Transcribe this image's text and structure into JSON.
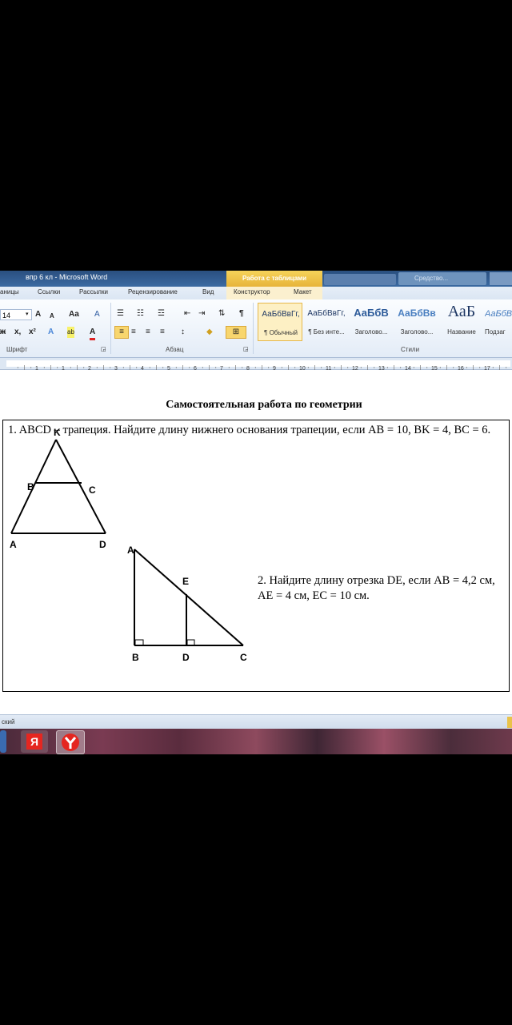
{
  "window": {
    "title": "впр 6 кл  -  Microsoft Word",
    "context_tab_header": "Работа с таблицами",
    "blurred_right_label": "Средство..."
  },
  "tabs": [
    "аницы",
    "Ссылки",
    "Рассылки",
    "Рецензирование",
    "Вид",
    "Конструктор",
    "Макет"
  ],
  "ribbon": {
    "font_size": "14",
    "groups": {
      "font": "Шрифт",
      "paragraph": "Абзац",
      "styles": "Стили"
    },
    "styles": [
      {
        "sample": "АаБбВвГг,",
        "name": "¶ Обычный"
      },
      {
        "sample": "АаБбВвГг,",
        "name": "¶ Без инте..."
      },
      {
        "sample": "АаБбВ",
        "name": "Заголово..."
      },
      {
        "sample": "АаБбВв",
        "name": "Заголово..."
      },
      {
        "sample": "АаБ",
        "name": "Название"
      },
      {
        "sample": "АаБбВ",
        "name": "Подзаг"
      }
    ],
    "glyphs": {
      "grow": "A",
      "shrink": "A",
      "case": "Aa",
      "clear": "A",
      "bold": "ж",
      "sub": "x,",
      "sup": "x²",
      "effects": "A",
      "highlight": "ab",
      "color": "A",
      "pilcrow": "¶"
    }
  },
  "ruler_numbers": [
    "1",
    "1",
    "2",
    "3",
    "4",
    "5",
    "6",
    "7",
    "8",
    "9",
    "10",
    "11",
    "12",
    "13",
    "14",
    "15",
    "16",
    "17",
    "18"
  ],
  "document": {
    "title": "Самостоятельная работа по геометрии",
    "task1": "1.  ABCD – трапеция. Найдите длину нижнего основания трапеции, если AB = 10, BK = 4, BC = 6.",
    "task2": " 2. Найдите длину отрезка DE, если AB = 4,2 см, AE = 4 см, EC = 10 см.",
    "figure1_labels": {
      "K": "K",
      "B": "B",
      "C": "C",
      "A": "A",
      "D": "D"
    },
    "figure2_labels": {
      "A": "A",
      "E": "E",
      "B": "B",
      "D": "D",
      "C": "C"
    }
  },
  "statusbar": {
    "language": "ский"
  },
  "taskbar": {
    "app1": "Я"
  }
}
